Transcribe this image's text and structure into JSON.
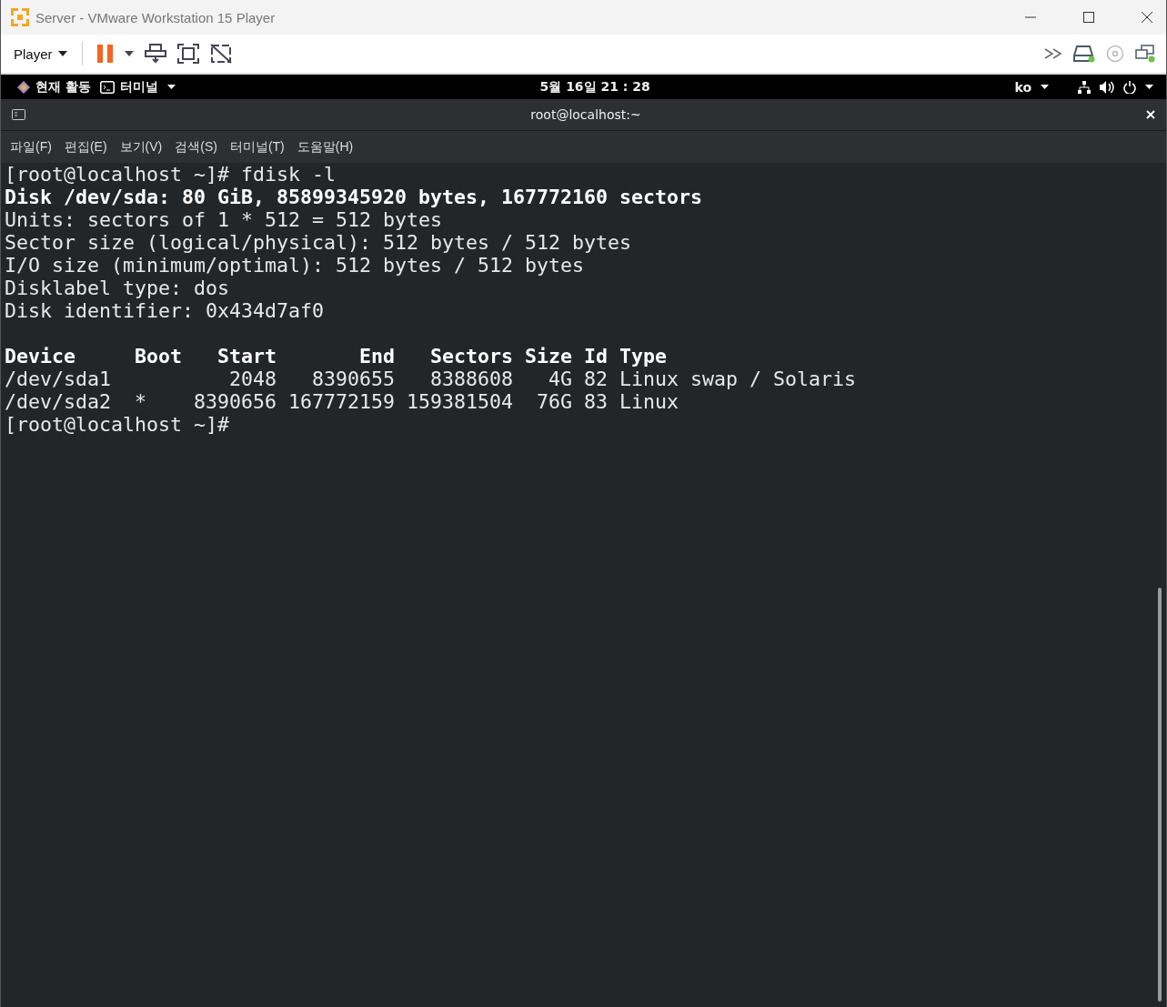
{
  "window": {
    "title": "Server - VMware Workstation 15 Player"
  },
  "toolbar": {
    "menu": "Player"
  },
  "top_bar": {
    "activities": "현재 활동",
    "app_menu": "터미널",
    "clock": "5월 16일  21 : 28",
    "input_method": "ko"
  },
  "terminal": {
    "title": "root@localhost:~",
    "menu": [
      "파일(F)",
      "편집(E)",
      "보기(V)",
      "검색(S)",
      "터미널(T)",
      "도움말(H)"
    ],
    "lines": [
      {
        "kind": "normal",
        "text": "[root@localhost ~]# fdisk -l"
      },
      {
        "kind": "bold",
        "text": "Disk /dev/sda: 80 GiB, 85899345920 bytes, 167772160 sectors"
      },
      {
        "kind": "normal",
        "text": "Units: sectors of 1 * 512 = 512 bytes"
      },
      {
        "kind": "normal",
        "text": "Sector size (logical/physical): 512 bytes / 512 bytes"
      },
      {
        "kind": "normal",
        "text": "I/O size (minimum/optimal): 512 bytes / 512 bytes"
      },
      {
        "kind": "normal",
        "text": "Disklabel type: dos"
      },
      {
        "kind": "normal",
        "text": "Disk identifier: 0x434d7af0"
      },
      {
        "kind": "blank"
      },
      {
        "kind": "bold",
        "text": "Device     Boot   Start       End   Sectors Size Id Type"
      },
      {
        "kind": "normal",
        "text": "/dev/sda1          2048   8390655   8388608   4G 82 Linux swap / Solaris"
      },
      {
        "kind": "normal",
        "text": "/dev/sda2  *    8390656 167772159 159381504  76G 83 Linux"
      },
      {
        "kind": "normal",
        "text": "[root@localhost ~]#"
      }
    ]
  }
}
